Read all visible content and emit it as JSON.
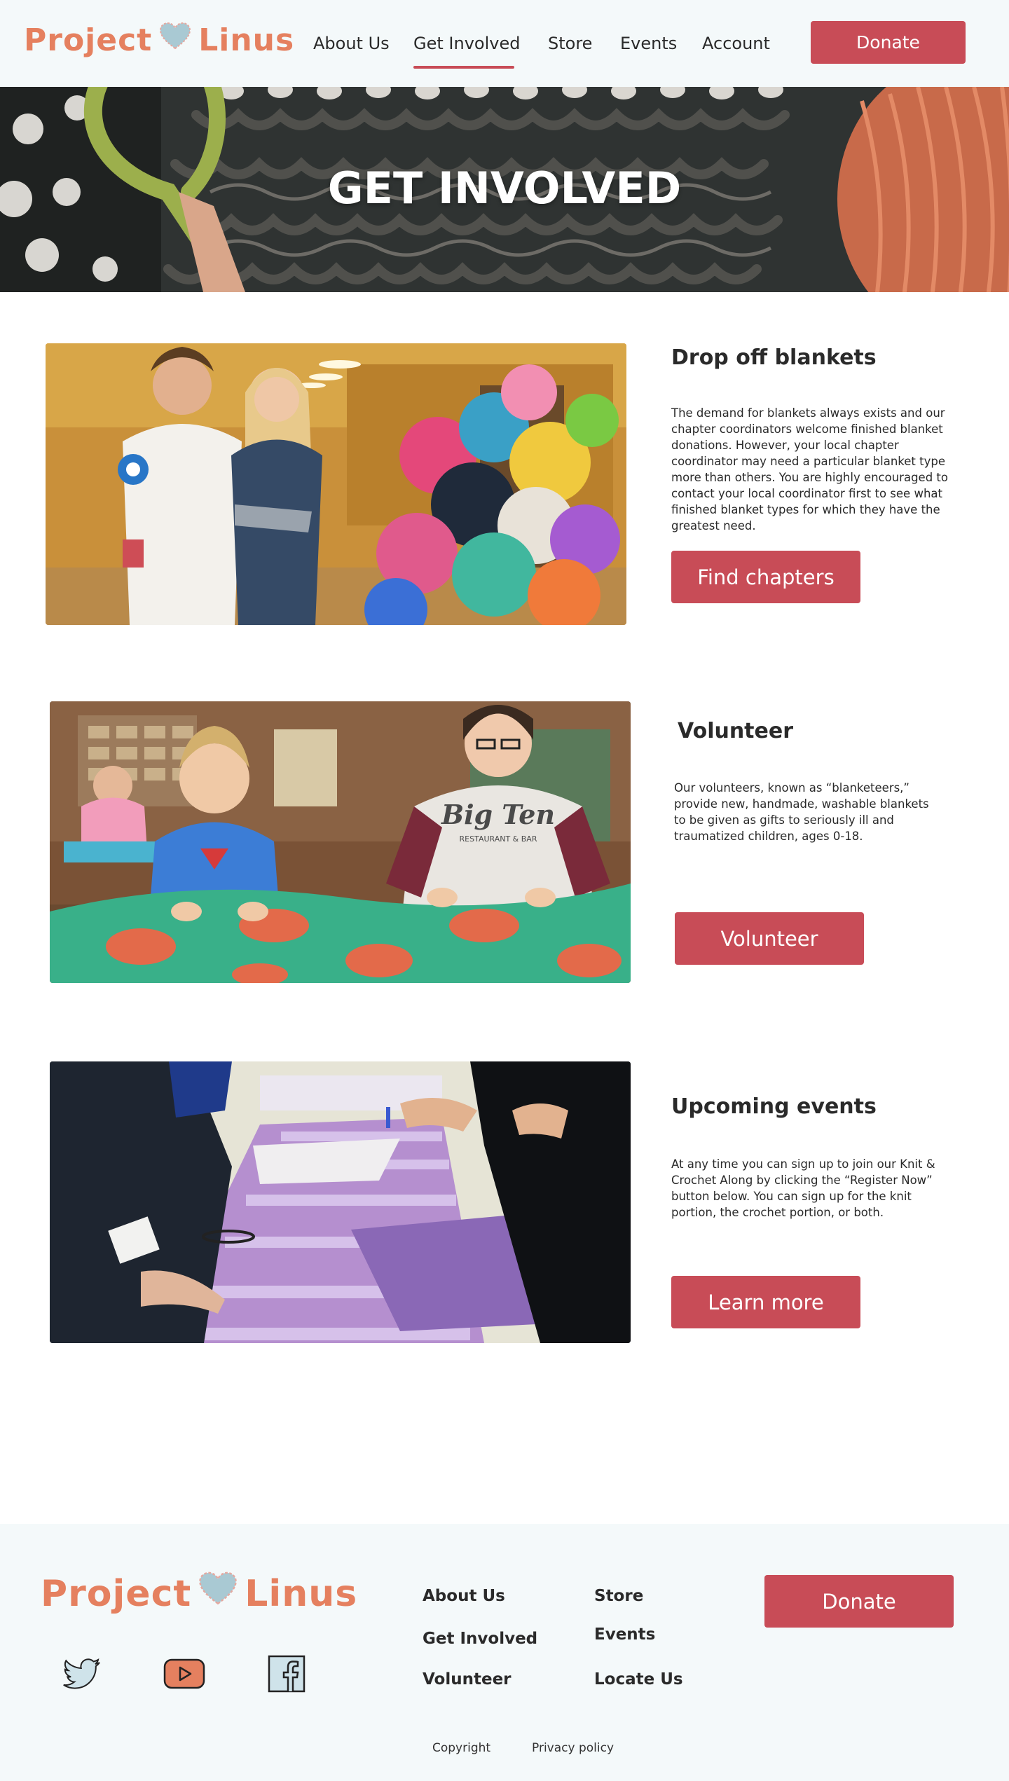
{
  "header": {
    "logo_left": "Project",
    "logo_right": "Linus",
    "nav": [
      "About Us",
      "Get Involved",
      "Store",
      "Events",
      "Account"
    ],
    "active_nav": "Get Involved",
    "donate_label": "Donate"
  },
  "hero": {
    "title": "GET INVOLVED"
  },
  "sections": [
    {
      "title": "Drop off blankets",
      "body": "The demand for blankets always exists and our chapter coordinators welcome finished blanket donations. However, your local chapter coordinator may need a particular blanket type more than others. You are highly encouraged to contact your local coordinator first to see what finished blanket types for which they have the greatest need.",
      "button": "Find chapters"
    },
    {
      "title": "Volunteer",
      "body": "Our volunteers, known as “blanketeers,” provide new, handmade, washable blankets to be given as gifts to seriously ill and traumatized children, ages 0-18.",
      "button": "Volunteer"
    },
    {
      "title": "Upcoming events",
      "body": "At any time you can sign up to join our Knit & Crochet Along by clicking the “Register Now” button below. You can sign up for the knit portion, the crochet portion, or both.",
      "button": "Learn more"
    }
  ],
  "photo_text": {
    "shirt_brand": "Big Ten",
    "shirt_sub": "RESTAURANT & BAR"
  },
  "footer": {
    "logo_left": "Project",
    "logo_right": "Linus",
    "col1": [
      "About Us",
      "Get Involved",
      "Volunteer"
    ],
    "col2": [
      "Store",
      "Events",
      "Locate Us"
    ],
    "donate_label": "Donate",
    "social_icons": [
      "twitter-icon",
      "youtube-icon",
      "facebook-icon"
    ],
    "bottom_links": [
      "Copyright",
      "Privacy policy"
    ]
  },
  "colors": {
    "brand_orange": "#e5805f",
    "accent_red": "#c84c57",
    "header_bg": "#f4f9fa",
    "heart_blue": "#a9c9d3"
  }
}
